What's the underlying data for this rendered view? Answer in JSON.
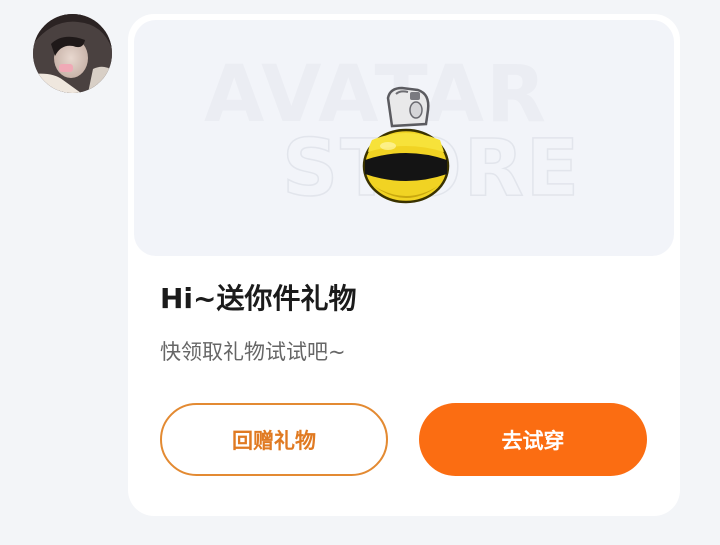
{
  "sender": {
    "avatar_alt": "avatar"
  },
  "gift_card": {
    "banner": {
      "watermark_line1": "AVATAR",
      "watermark_line2": "STORE",
      "item_icon": "bee-jar-icon"
    },
    "title": "Hi~送你件礼物",
    "subtitle": "快领取礼物试试吧~",
    "buttons": {
      "return_gift_label": "回赠礼物",
      "try_on_label": "去试穿"
    }
  },
  "colors": {
    "accent": "#fb6d12",
    "outline_button": "#e38a32",
    "background": "#f3f5f8"
  }
}
